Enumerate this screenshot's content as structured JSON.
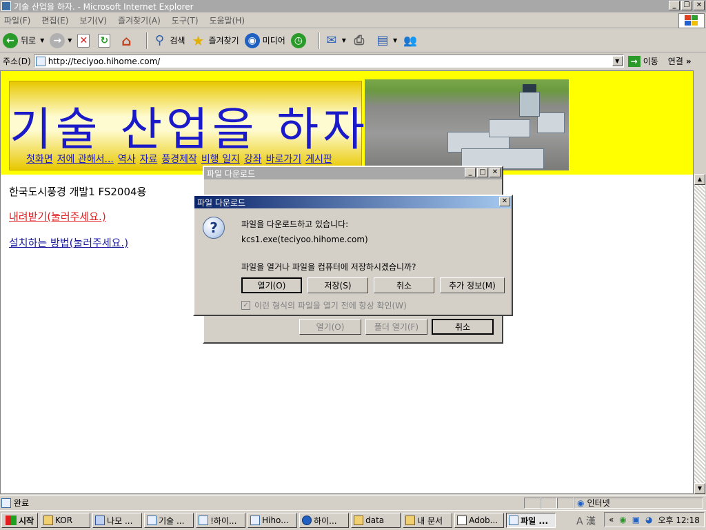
{
  "window": {
    "title": "기술 산업을 하자. - Microsoft Internet Explorer"
  },
  "menu": [
    "파일(F)",
    "편집(E)",
    "보기(V)",
    "즐겨찾기(A)",
    "도구(T)",
    "도움말(H)"
  ],
  "toolbar": {
    "back": "뒤로",
    "search": "검색",
    "favorites": "즐겨찾기",
    "media": "미디어"
  },
  "address": {
    "label": "주소(D)",
    "url": "http://teciyoo.hihome.com/",
    "go": "이동",
    "links": "연결"
  },
  "banner": {
    "title": "기술 산업을 하자",
    "nav": [
      "첫화면",
      "저에 관해서...",
      "역사",
      "자료",
      "풍경제작",
      "비행 일지",
      "강좌",
      "바로가기",
      "게시판"
    ]
  },
  "page": {
    "heading": "한국도시풍경 개발1 FS2004용",
    "download_link": "내려받기(눌러주세요.)",
    "install_link": "설치하는 방법(눌러주세요.)"
  },
  "dialog_back": {
    "title": "파일 다운로드",
    "open": "열기(O)",
    "open_folder": "폴더 열기(F)",
    "cancel": "취소"
  },
  "dialog_front": {
    "title": "파일 다운로드",
    "message": "파일을 다운로드하고 있습니다:",
    "filename": "kcs1.exe(teciyoo.hihome.com)",
    "question": "파일을 열거나 파일을 컴퓨터에 저장하시겠습니까?",
    "btn_open": "열기(O)",
    "btn_save": "저장(S)",
    "btn_cancel": "취소",
    "btn_more": "추가 정보(M)",
    "checkbox": "이런 형식의 파일을 열기 전에 항상 확인(W)"
  },
  "status": {
    "text": "완료",
    "zone": "인터넷"
  },
  "taskbar": {
    "start": "시작",
    "tasks": [
      "KOR",
      "나모 ...",
      "기술 ...",
      "!하이...",
      "Hiho...",
      "하이...",
      "data",
      "내 문서",
      "Adob...",
      "파일 ..."
    ],
    "ime": "A 漢",
    "clock": "오후 12:18"
  }
}
